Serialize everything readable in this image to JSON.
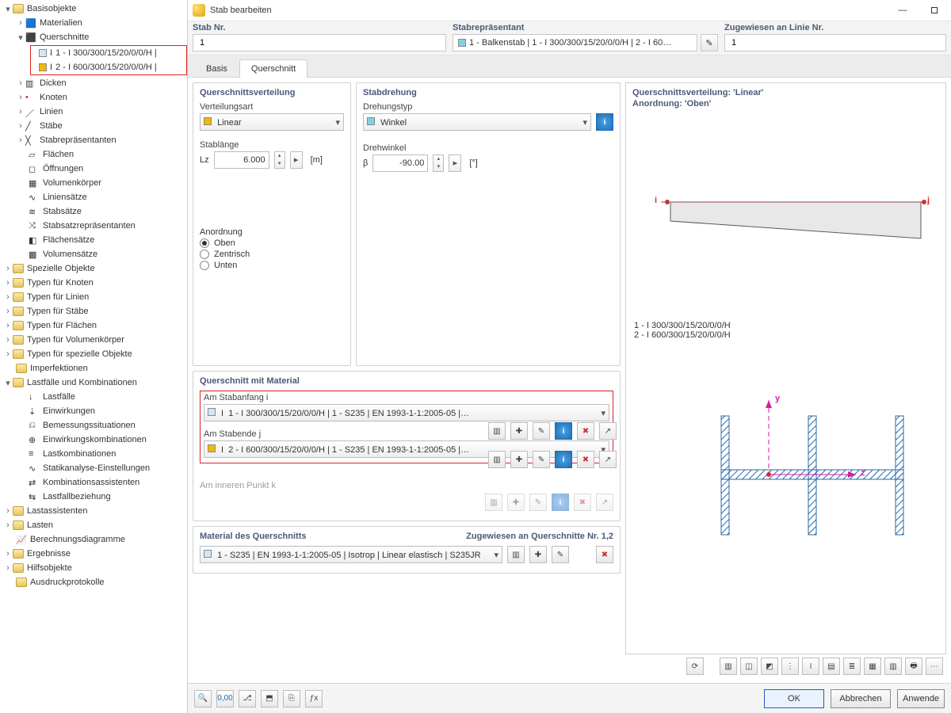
{
  "window": {
    "title": "Stab bearbeiten"
  },
  "tree": {
    "root": "Basisobjekte",
    "materials": "Materialien",
    "crosssections": "Querschnitte",
    "cs1": "1 - I 300/300/15/20/0/0/H |",
    "cs2": "2 - I 600/300/15/20/0/0/H |",
    "dicken": "Dicken",
    "knoten": "Knoten",
    "linien": "Linien",
    "staebe": "Stäbe",
    "stabrep": "Stabrepräsentanten",
    "flaechen": "Flächen",
    "oeffnungen": "Öffnungen",
    "volumen": "Volumenkörper",
    "liniensaetze": "Liniensätze",
    "stabsaetze": "Stabsätze",
    "stabsatzrep": "Stabsatzrepräsentanten",
    "flaechensaetze": "Flächensätze",
    "volumensaetze": "Volumensätze",
    "spezielle": "Spezielle Objekte",
    "typknoten": "Typen für Knoten",
    "typlinien": "Typen für Linien",
    "typstaebe": "Typen für Stäbe",
    "typflaechen": "Typen für Flächen",
    "typvol": "Typen für Volumenkörper",
    "typspezielle": "Typen für spezielle Objekte",
    "imperf": "Imperfektionen",
    "lfkomb": "Lastfälle und Kombinationen",
    "lf": "Lastfälle",
    "einw": "Einwirkungen",
    "bemessungs": "Bemessungssituationen",
    "einwkomb": "Einwirkungskombinationen",
    "lastkomb": "Lastkombinationen",
    "statik": "Statikanalyse-Einstellungen",
    "kombass": "Kombinationsassistenten",
    "lfbez": "Lastfallbeziehung",
    "lastass": "Lastassistenten",
    "lasten": "Lasten",
    "berechn": "Berechnungsdiagramme",
    "ergebnisse": "Ergebnisse",
    "hilfs": "Hilfsobjekte",
    "protokolle": "Ausdruckprotokolle"
  },
  "top": {
    "stabnr_label": "Stab Nr.",
    "stabnr_value": "1",
    "stabrep_label": "Stabrepräsentant",
    "stabrep_value": "1 - Balkenstab | 1 - I 300/300/15/20/0/0/H | 2 - I 60…",
    "assigned_label": "Zugewiesen an Linie Nr.",
    "assigned_value": "1"
  },
  "tabs": {
    "basis": "Basis",
    "querschnitt": "Querschnitt"
  },
  "distribution": {
    "panel": "Querschnittsverteilung",
    "verteilungsart_label": "Verteilungsart",
    "verteilungsart_value": "Linear",
    "stablaenge_label": "Stablänge",
    "lz_label": "Lz",
    "lz_value": "6.000",
    "lz_unit": "[m]",
    "anordnung_label": "Anordnung",
    "opt_oben": "Oben",
    "opt_zentrisch": "Zentrisch",
    "opt_unten": "Unten"
  },
  "rotation": {
    "panel": "Stabdrehung",
    "typ_label": "Drehungstyp",
    "typ_value": "Winkel",
    "winkel_label": "Drehwinkel",
    "beta_label": "β",
    "beta_value": "-90.00",
    "beta_unit": "[°]"
  },
  "material": {
    "panel": "Querschnitt mit Material",
    "start_label": "Am Stabanfang i",
    "start_value": "1 - I 300/300/15/20/0/0/H | 1 - S235 | EN 1993-1-1:2005-05 |…",
    "end_label": "Am Stabende j",
    "end_value": "2 - I 600/300/15/20/0/0/H | 1 - S235 | EN 1993-1-1:2005-05 |…",
    "inner_label": "Am inneren Punkt k",
    "matpanel": "Material des Querschnitts",
    "mat_assigned": "Zugewiesen an Querschnitte Nr. 1,2",
    "mat_value": "1 - S235 | EN 1993-1-1:2005-05 | Isotrop | Linear elastisch | S235JR"
  },
  "preview": {
    "caption1": "Querschnittsverteilung: 'Linear'",
    "caption2": "Anordnung: 'Oben'",
    "section1": "1 - I 300/300/15/20/0/0/H",
    "section2": "2 - I 600/300/15/20/0/0/H",
    "node_i": "i",
    "node_j": "j",
    "axis_y": "y",
    "axis_z": "z"
  },
  "buttons": {
    "ok": "OK",
    "cancel": "Abbrechen",
    "apply": "Anwende"
  }
}
